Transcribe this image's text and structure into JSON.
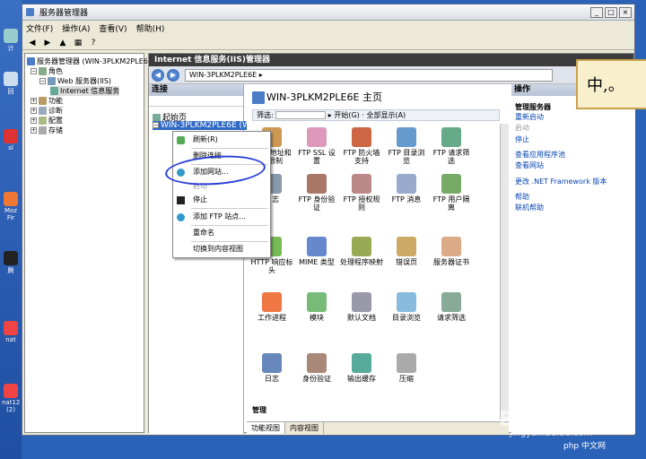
{
  "window": {
    "title": "服务器管理器",
    "controls": [
      "_",
      "□",
      "×"
    ]
  },
  "menu": [
    "文件(F)",
    "操作(A)",
    "查看(V)",
    "帮助(H)"
  ],
  "tree": {
    "root": "服务器管理器 (WIN-3PLKM2PLE6I",
    "roles": "角色",
    "web": "Web 服务器(IIS)",
    "iis": "Internet 信息服务",
    "features": "功能",
    "diag": "诊断",
    "config": "配置",
    "storage": "存储"
  },
  "iis": {
    "title": "Internet 信息服务(IIS)管理器",
    "address": "WIN-3PLKM2PLE6E ▸",
    "conn_title": "连接",
    "start": "起始页",
    "server": "WIN-3PLKM2PLE6E (WI",
    "page_title": "WIN-3PLKM2PLE6E 主页",
    "filter": "筛选:",
    "go": "开始(G)",
    "showall": "全部显示(A)",
    "section_ftp_tail": "P",
    "section_mgmt": "管理",
    "icons": [
      "IPv4 地址和域限制",
      "FTP SSL 设置",
      "FTP 防火墙支持",
      "FTP 目录浏览",
      "FTP 请求筛选",
      "日志",
      "FTP 身份验证",
      "FTP 授权规则",
      "FTP 消息",
      "FTP 用户隔离",
      "HTTP 响应标头",
      "MIME 类型",
      "处理程序映射",
      "错误页",
      "服务器证书",
      "工作进程",
      "模块",
      "默认文档",
      "目录浏览",
      "请求筛选",
      "日志",
      "身份验证",
      "输出缓存",
      "压缩"
    ],
    "tabs": [
      "功能视图",
      "内容视图"
    ]
  },
  "actions": {
    "title": "操作",
    "manage": "管理服务器",
    "restart": "重新启动",
    "start": "启动",
    "stop": "停止",
    "pools": "查看应用程序池",
    "sites": "查看网站",
    "framework": "更改 .NET Framework 版本",
    "help": "帮助",
    "online": "联机帮助"
  },
  "context_menu": [
    "刷新(R)",
    "删除连接",
    "添加网站...",
    "启动",
    "停止",
    "添加 FTP 站点...",
    "重命名",
    "切换到内容视图"
  ],
  "desktop": [
    "计",
    "回",
    "sl",
    "Moz Fir",
    "腾",
    "nat",
    "nat12 (2)"
  ],
  "overlay": {
    "cn": "中,。",
    "watermark": "Baidu 经验",
    "wm2": "jingyan.baidu.com",
    "php": "php 中文网"
  }
}
